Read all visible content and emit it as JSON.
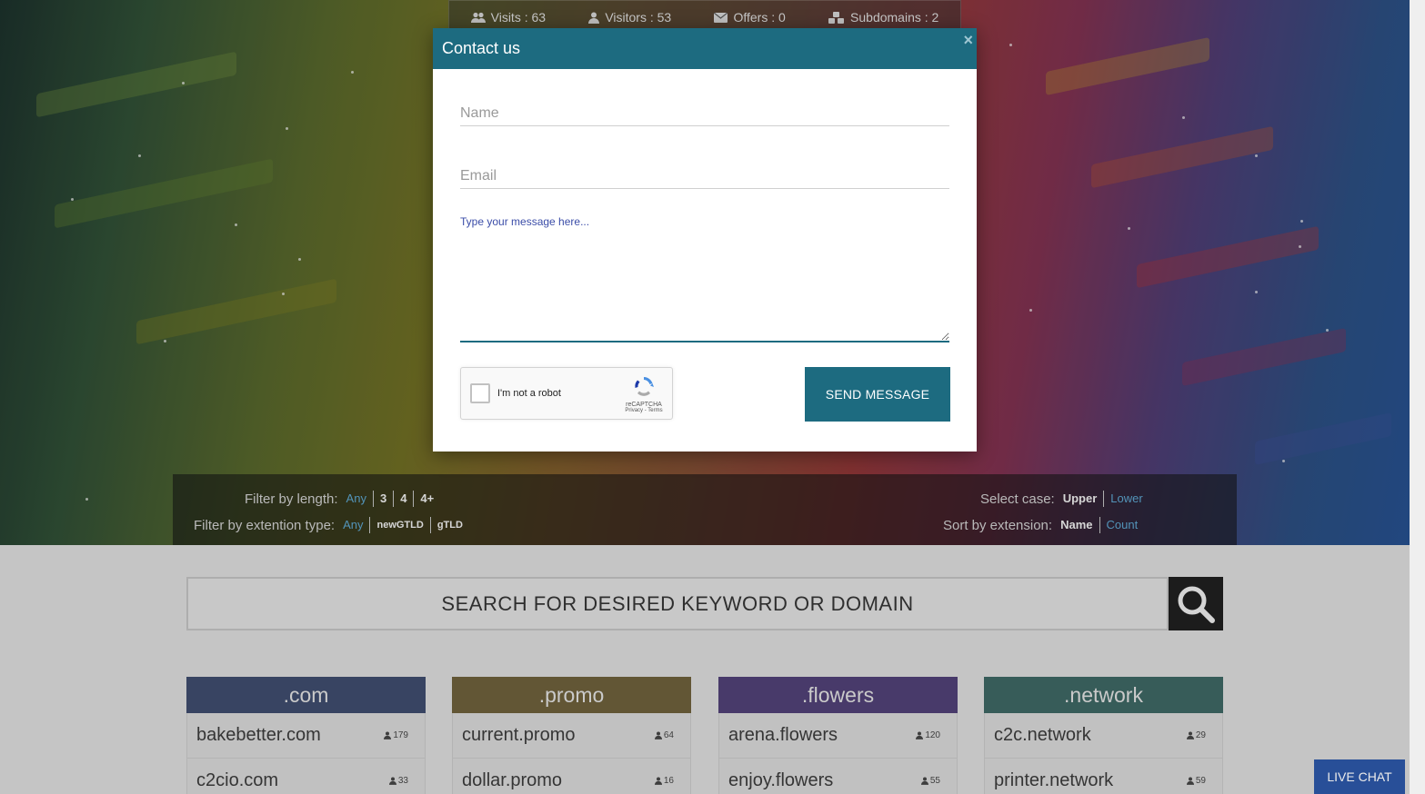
{
  "stats": [
    {
      "icon": "users-icon",
      "label": "Visits : 63"
    },
    {
      "icon": "user-icon",
      "label": "Visitors : 53"
    },
    {
      "icon": "envelope-icon",
      "label": "Offers : 0"
    },
    {
      "icon": "cubes-icon",
      "label": "Subdomains : 2"
    }
  ],
  "modal": {
    "title": "Contact us",
    "close": "×",
    "name_placeholder": "Name",
    "email_placeholder": "Email",
    "message_label": "Type your message here...",
    "captcha_label": "I'm not a robot",
    "captcha_brand": "reCAPTCHA",
    "captcha_terms": "Privacy - Terms",
    "send_label": "SEND MESSAGE"
  },
  "filters": {
    "length_label": "Filter by length:",
    "length_options": [
      "Any",
      "3",
      "4",
      "4+"
    ],
    "ext_label": "Filter by extention type:",
    "ext_options": [
      "Any",
      "newGTLD",
      "gTLD"
    ],
    "case_label": "Select case:",
    "case_options": [
      "Upper",
      "Lower"
    ],
    "sort_label": "Sort by extension:",
    "sort_options": [
      "Name",
      "Count"
    ]
  },
  "search": {
    "placeholder": "SEARCH FOR DESIRED KEYWORD OR DOMAIN"
  },
  "columns": [
    {
      "ext": ".com",
      "color": "#3d4a6b",
      "rows": [
        {
          "domain": "bakebetter.com",
          "count": "179"
        },
        {
          "domain": "c2cio.com",
          "count": "33"
        }
      ]
    },
    {
      "ext": ".promo",
      "color": "#6b5e3a",
      "rows": [
        {
          "domain": "current.promo",
          "count": "64"
        },
        {
          "domain": "dollar.promo",
          "count": "16"
        }
      ]
    },
    {
      "ext": ".flowers",
      "color": "#4f3f73",
      "rows": [
        {
          "domain": "arena.flowers",
          "count": "120"
        },
        {
          "domain": "enjoy.flowers",
          "count": "55"
        }
      ]
    },
    {
      "ext": ".network",
      "color": "#3c6461",
      "rows": [
        {
          "domain": "c2c.network",
          "count": "29"
        },
        {
          "domain": "printer.network",
          "count": "59"
        }
      ]
    }
  ],
  "live_chat": "LIVE CHAT"
}
